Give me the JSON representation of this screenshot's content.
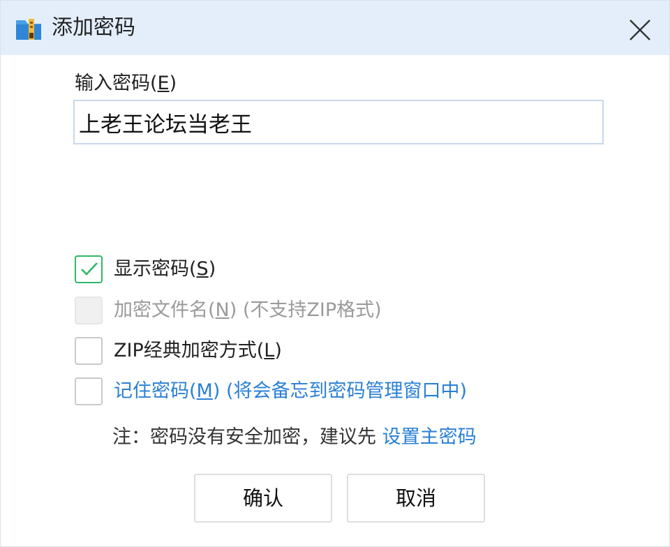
{
  "window": {
    "title": "添加密码",
    "icon": "archive-folder-icon",
    "close_icon": "close-icon"
  },
  "password": {
    "label_text": "输入密码(",
    "label_mnemonic": "E",
    "label_end": ")",
    "value": "上老王论坛当老王"
  },
  "options": {
    "show_password": {
      "checked": true,
      "label": "显示密码(",
      "mnemonic": "S",
      "end": ")"
    },
    "encrypt_filename": {
      "checked": false,
      "disabled": true,
      "label": "加密文件名(",
      "mnemonic": "N",
      "end": ") (不支持ZIP格式)"
    },
    "zip_classic": {
      "checked": false,
      "label": "ZIP经典加密方式(",
      "mnemonic": "L",
      "end": ")"
    },
    "remember": {
      "checked": false,
      "label": "记住密码(",
      "mnemonic": "M",
      "end": ") (将会备忘到密码管理窗口中)"
    }
  },
  "note": {
    "text": "注：密码没有安全加密，建议先 ",
    "link": "设置主密码"
  },
  "buttons": {
    "ok": "确认",
    "cancel": "取消"
  },
  "colors": {
    "titlebar_bg": "#e4eefa",
    "check_green": "#2fb866",
    "link_blue": "#2a7fd4"
  }
}
